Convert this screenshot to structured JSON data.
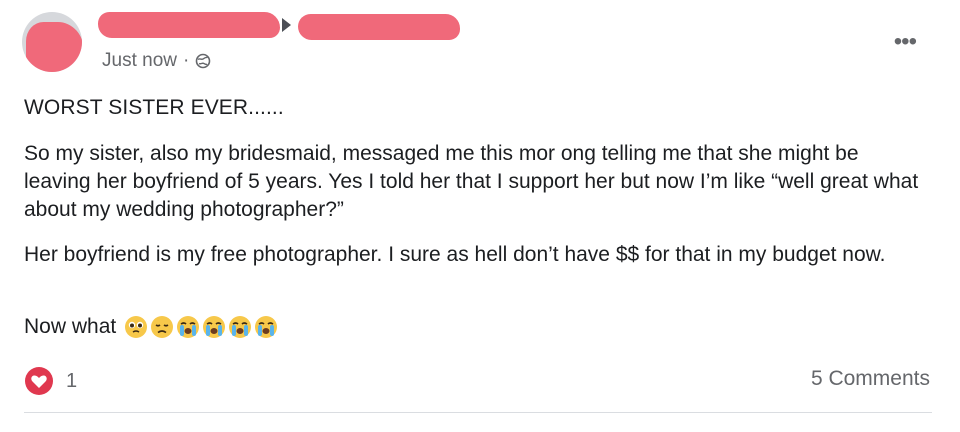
{
  "post": {
    "timestamp": "Just now",
    "separator": "·",
    "privacy_icon": "globe-icon",
    "more_label": "•••",
    "headline": "WORST SISTER EVER......",
    "paragraphs": [
      "So my sister, also my bridesmaid, messaged me this mor ong telling me that she might be leaving her boyfriend of 5 years. Yes I told her that I support her but now I’m like “well great what about my wedding photographer?”",
      "Her boyfriend is my free photographer. I sure as hell don’t have $$ for that in my budget now."
    ],
    "closing": "Now what",
    "emojis": [
      "pleading-face-icon",
      "disappointed-face-icon",
      "crying-face-icon",
      "crying-face-icon",
      "crying-face-icon",
      "crying-face-icon"
    ],
    "reaction_icon": "heart-icon",
    "reaction_count": "1",
    "comments_label": "5 Comments"
  },
  "colors": {
    "text": "#1c1e21",
    "secondary": "#65676b",
    "redaction": "#f0697a",
    "heart": "#e0384f",
    "emoji": "#f7c84a",
    "tear": "#5ab4ea"
  }
}
